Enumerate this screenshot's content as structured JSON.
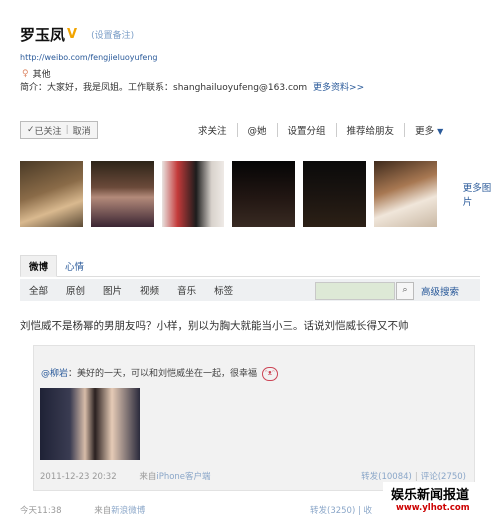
{
  "profile": {
    "name": "罗玉凤",
    "verified_mark": "V",
    "remark_link": "(设置备注)",
    "url": "http://weibo.com/fengjieluoyufeng",
    "gender_icon": "female-icon",
    "location": "其他",
    "bio": "简介：大家好，我是凤姐。工作联系：shanghailuoyufeng@163.com",
    "more_info": "更多资料>>"
  },
  "actions": {
    "following": "已关注",
    "cancel": "取消",
    "items": [
      "求关注",
      "@她",
      "设置分组",
      "推荐给朋友",
      "更多"
    ]
  },
  "photos": {
    "more": "更多图片"
  },
  "tabs": [
    "微博",
    "心情"
  ],
  "filters": [
    "全部",
    "原创",
    "图片",
    "视频",
    "音乐",
    "标签"
  ],
  "search": {
    "advanced": "高级搜索"
  },
  "post": {
    "text": "刘恺威不是杨幂的男朋友吗？小样，别以为胸大就能当小三。话说刘恺威长得又不帅",
    "repost": {
      "user": "@柳岩",
      "text": "：美好的一天，可以和刘恺威坐在一起，很幸福",
      "time": "2011-12-23 20:32",
      "source_label": "来自",
      "source_app": "iPhone客户端",
      "forward": "转发(10084)",
      "comment": "评论(2750)"
    },
    "footer": {
      "time": "今天11:38",
      "source_label": "来自",
      "source_app": "新浪微博",
      "forward": "转发(3250)",
      "comment": "收"
    }
  },
  "watermark": {
    "title": "娱乐新闻报道",
    "url": "www.ylhot.com"
  },
  "colors": {
    "link": "#2a5a9a",
    "verified": "#f2a400"
  }
}
